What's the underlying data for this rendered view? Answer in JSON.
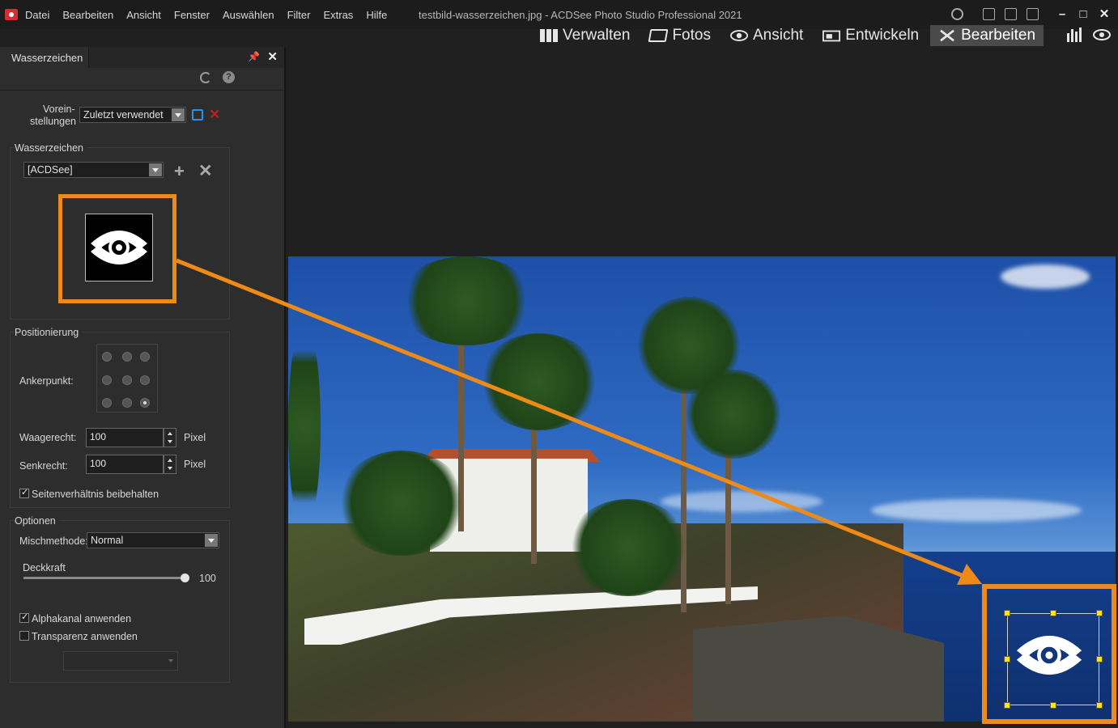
{
  "menubar": {
    "items": [
      "Datei",
      "Bearbeiten",
      "Ansicht",
      "Fenster",
      "Auswählen",
      "Filter",
      "Extras",
      "Hilfe"
    ],
    "window_title": "testbild-wasserzeichen.jpg - ACDSee Photo Studio Professional 2021"
  },
  "modes": {
    "manage": "Verwalten",
    "photos": "Fotos",
    "view": "Ansicht",
    "develop": "Entwickeln",
    "edit": "Bearbeiten",
    "active": "Bearbeiten"
  },
  "panel": {
    "tab_title": "Wasserzeichen",
    "presets_label_1": "Vorein-",
    "presets_label_2": "stellungen",
    "preset_value": "Zuletzt verwendet",
    "watermark_group": "Wasserzeichen",
    "watermark_value": "[ACDSee]",
    "positioning_group": "Positionierung",
    "anchor_label": "Ankerpunkt:",
    "anchor_selected": "bottom-right",
    "horizontal_label": "Waagerecht:",
    "horizontal_value": "100",
    "vertical_label": "Senkrecht:",
    "vertical_value": "100",
    "unit": "Pixel",
    "keep_aspect_label": "Seitenverhältnis beibehalten",
    "keep_aspect_checked": true,
    "options_group": "Optionen",
    "blend_label": "Mischmethode:",
    "blend_value": "Normal",
    "opacity_label": "Deckkraft",
    "opacity_value": "100",
    "alpha_label": "Alphakanal anwenden",
    "alpha_checked": true,
    "transparency_label": "Transparenz anwenden",
    "transparency_checked": false
  },
  "colors": {
    "highlight": "#f08a16",
    "handle": "#ffe800",
    "accent_blue": "#2f8fe0",
    "delete_red": "#b52222"
  }
}
